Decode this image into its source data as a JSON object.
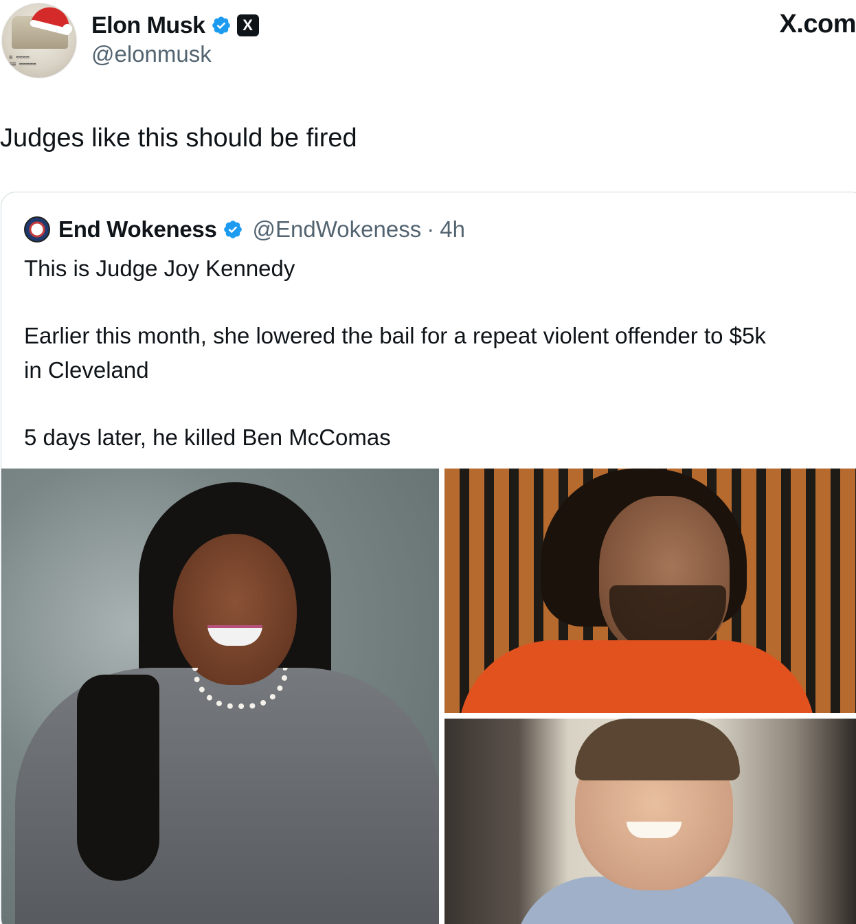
{
  "author": {
    "display_name": "Elon Musk",
    "handle": "@elonmusk",
    "verified": true,
    "affiliate_badge": "X"
  },
  "source_mark": "X.com",
  "tweet": {
    "text": "Judges like this should be fired"
  },
  "quoted_tweet": {
    "display_name": "End Wokeness",
    "handle": "@EndWokeness",
    "separator": "·",
    "time": "4h",
    "verified": true,
    "lines": [
      "This is Judge Joy Kennedy",
      "Earlier this month, she lowered the bail for a repeat violent offender to $5k",
      "in Cleveland",
      "5 days later, he killed Ben McComas"
    ]
  },
  "icons": {
    "verified": "verified-badge-icon",
    "x_logo": "x-logo-icon"
  },
  "colors": {
    "text_primary": "#0f1419",
    "text_secondary": "#536471",
    "verified_blue": "#1d9bf0",
    "border": "#cfd9de"
  }
}
